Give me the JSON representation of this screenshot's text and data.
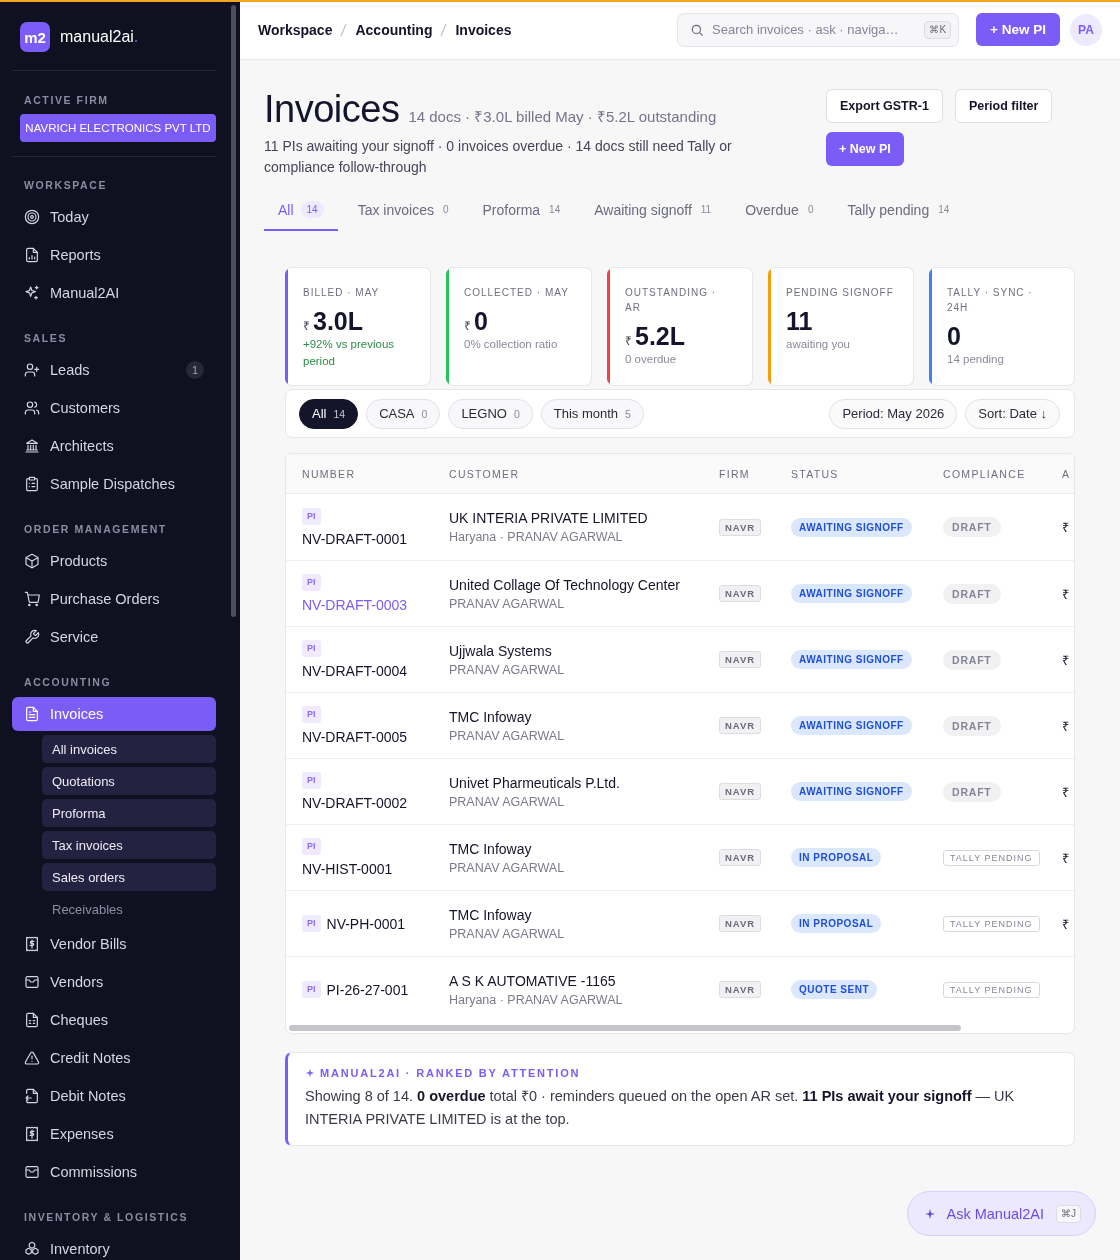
{
  "top_bar": {
    "breadcrumb": [
      "Workspace",
      "Accounting",
      "Invoices"
    ],
    "search": {
      "placeholder": "Search invoices · ask · naviga…",
      "shortcut": "⌘K"
    },
    "primary_action": "+ New PI",
    "avatar": "PA"
  },
  "sidebar": {
    "logo": {
      "mark": "m2",
      "name": "manual2ai",
      "accent": "."
    },
    "active_firm": {
      "label": "ACTIVE FIRM",
      "name": "NAVRICH ELECTRONICS PVT LTD"
    },
    "sections": [
      {
        "title": "WORKSPACE",
        "items": [
          {
            "label": "Today",
            "selected": false
          },
          {
            "label": "Reports",
            "selected": false
          },
          {
            "label": "Manual2AI",
            "selected": false
          }
        ]
      },
      {
        "title": "SALES",
        "items": [
          {
            "label": "Leads",
            "selected": false,
            "badge": "1"
          },
          {
            "label": "Customers",
            "selected": false
          },
          {
            "label": "Architects",
            "selected": false
          },
          {
            "label": "Sample Dispatches",
            "selected": false
          }
        ]
      },
      {
        "title": "ORDER MANAGEMENT",
        "items": [
          {
            "label": "Products",
            "selected": false
          },
          {
            "label": "Purchase Orders",
            "selected": false
          },
          {
            "label": "Service",
            "selected": false
          }
        ]
      },
      {
        "title": "ACCOUNTING",
        "items": [
          {
            "label": "Invoices",
            "selected": true,
            "children": [
              {
                "label": "All invoices",
                "disabled": false
              },
              {
                "label": "Quotations",
                "disabled": false
              },
              {
                "label": "Proforma",
                "disabled": false
              },
              {
                "label": "Tax invoices",
                "disabled": false
              },
              {
                "label": "Sales orders",
                "disabled": false
              },
              {
                "label": "Receivables",
                "disabled": true
              }
            ]
          },
          {
            "label": "Vendor Bills",
            "selected": false
          },
          {
            "label": "Vendors",
            "selected": false
          },
          {
            "label": "Cheques",
            "selected": false
          },
          {
            "label": "Credit Notes",
            "selected": false
          },
          {
            "label": "Debit Notes",
            "selected": false
          },
          {
            "label": "Expenses",
            "selected": false
          },
          {
            "label": "Commissions",
            "selected": false
          }
        ]
      },
      {
        "title": "INVENTORY & LOGISTICS",
        "items": [
          {
            "label": "Inventory",
            "selected": false
          }
        ]
      }
    ]
  },
  "page_header": {
    "title": "Invoices",
    "summary": "14 docs · ₹3.0L billed May · ₹5.2L outstanding",
    "description": "11 PIs awaiting your signoff · 0 invoices overdue · 14 docs still need Tally or compliance follow-through",
    "actions": [
      {
        "label": "Export GSTR-1",
        "kind": "secondary"
      },
      {
        "label": "Period filter",
        "kind": "secondary"
      },
      {
        "label": "+ New PI",
        "kind": "primary"
      }
    ]
  },
  "tabs": [
    {
      "label": "All",
      "count": "14",
      "selected": true
    },
    {
      "label": "Tax invoices",
      "count": "0",
      "selected": false
    },
    {
      "label": "Proforma",
      "count": "14",
      "selected": false
    },
    {
      "label": "Awaiting signoff",
      "count": "11",
      "selected": false
    },
    {
      "label": "Overdue",
      "count": "0",
      "selected": false
    },
    {
      "label": "Tally pending",
      "count": "14",
      "selected": false
    }
  ],
  "kpis": [
    {
      "label": "BILLED · MAY",
      "currency": "₹",
      "value": "3.0L",
      "note": "+92% vs previous period",
      "positive": true,
      "color": "#7b5cf6"
    },
    {
      "label": "COLLECTED · MAY",
      "currency": "₹",
      "value": "0",
      "note": "0% collection ratio",
      "positive": false,
      "color": "#22c55e"
    },
    {
      "label": "OUTSTANDING · AR",
      "currency": "₹",
      "value": "5.2L",
      "note": "0 overdue",
      "positive": false,
      "color": "#ef4444"
    },
    {
      "label": "PENDING SIGNOFF",
      "value": "11",
      "note": "awaiting you",
      "positive": false,
      "color": "#f59e0b"
    },
    {
      "label": "TALLY · SYNC · 24H",
      "value": "0",
      "note": "14 pending",
      "positive": false,
      "color": "#3b82f6"
    }
  ],
  "filters": {
    "chips": [
      {
        "label": "All",
        "count": "14",
        "selected": true
      },
      {
        "label": "CASA",
        "count": "0",
        "selected": false
      },
      {
        "label": "LEGNO",
        "count": "0",
        "selected": false
      },
      {
        "label": "This month",
        "count": "5",
        "selected": false
      }
    ],
    "period": "Period: May 2026",
    "sort": "Sort: Date ↓"
  },
  "table": {
    "columns": [
      "NUMBER",
      "CUSTOMER",
      "FIRM",
      "STATUS",
      "COMPLIANCE",
      "A"
    ],
    "rows": [
      {
        "type": "PI",
        "number": "NV-DRAFT-0001",
        "hovered": false,
        "customer": "UK INTERIA PRIVATE LIMITED",
        "customer_detail": "Haryana · PRANAV AGARWAL",
        "firm": "NAVR",
        "status": "AWAITING SIGNOFF",
        "compliance": {
          "label": "DRAFT",
          "kind": "draft"
        },
        "column_6": "₹"
      },
      {
        "type": "PI",
        "number": "NV-DRAFT-0003",
        "hovered": true,
        "customer": "United Collage Of Technology Center",
        "customer_detail": "PRANAV AGARWAL",
        "firm": "NAVR",
        "status": "AWAITING SIGNOFF",
        "compliance": {
          "label": "DRAFT",
          "kind": "draft"
        },
        "column_6": "₹"
      },
      {
        "type": "PI",
        "number": "NV-DRAFT-0004",
        "hovered": false,
        "customer": "Ujjwala Systems",
        "customer_detail": "PRANAV AGARWAL",
        "firm": "NAVR",
        "status": "AWAITING SIGNOFF",
        "compliance": {
          "label": "DRAFT",
          "kind": "draft"
        },
        "column_6": "₹"
      },
      {
        "type": "PI",
        "number": "NV-DRAFT-0005",
        "hovered": false,
        "customer": "TMC Infoway",
        "customer_detail": "PRANAV AGARWAL",
        "firm": "NAVR",
        "status": "AWAITING SIGNOFF",
        "compliance": {
          "label": "DRAFT",
          "kind": "draft"
        },
        "column_6": "₹"
      },
      {
        "type": "PI",
        "number": "NV-DRAFT-0002",
        "hovered": false,
        "customer": "Univet Pharmeuticals P.Ltd.",
        "customer_detail": "PRANAV AGARWAL",
        "firm": "NAVR",
        "status": "AWAITING SIGNOFF",
        "compliance": {
          "label": "DRAFT",
          "kind": "draft"
        },
        "column_6": "₹"
      },
      {
        "type": "PI",
        "number": "NV-HIST-0001",
        "hovered": false,
        "customer": "TMC Infoway",
        "customer_detail": "PRANAV AGARWAL",
        "firm": "NAVR",
        "status": "IN PROPOSAL",
        "compliance": {
          "label": "TALLY PENDING",
          "kind": "pending"
        },
        "column_6": "₹"
      },
      {
        "type": "PI",
        "number": "NV-PH-0001",
        "hovered": false,
        "customer": "TMC Infoway",
        "customer_detail": "PRANAV AGARWAL",
        "firm": "NAVR",
        "status": "IN PROPOSAL",
        "compliance": {
          "label": "TALLY PENDING",
          "kind": "pending"
        },
        "column_6": "₹"
      },
      {
        "type": "PI",
        "number": "PI-26-27-001",
        "hovered": false,
        "customer": "A S K AUTOMATIVE -1165",
        "customer_detail": "Haryana · PRANAV AGARWAL",
        "firm": "NAVR",
        "status": "QUOTE SENT",
        "compliance": {
          "label": "TALLY PENDING",
          "kind": "pending"
        }
      }
    ]
  },
  "ai_note": {
    "heading": "MANUAL2AI · RANKED BY ATTENTION",
    "text": "Showing 8 of 14. **0 overdue** total ₹0 · reminders queued on the open AR set. **11 PIs await your signoff** — UK INTERIA PRIVATE LIMITED is at the top."
  },
  "ask_button": {
    "label": "Ask Manual2AI",
    "shortcut": "⌘J"
  }
}
